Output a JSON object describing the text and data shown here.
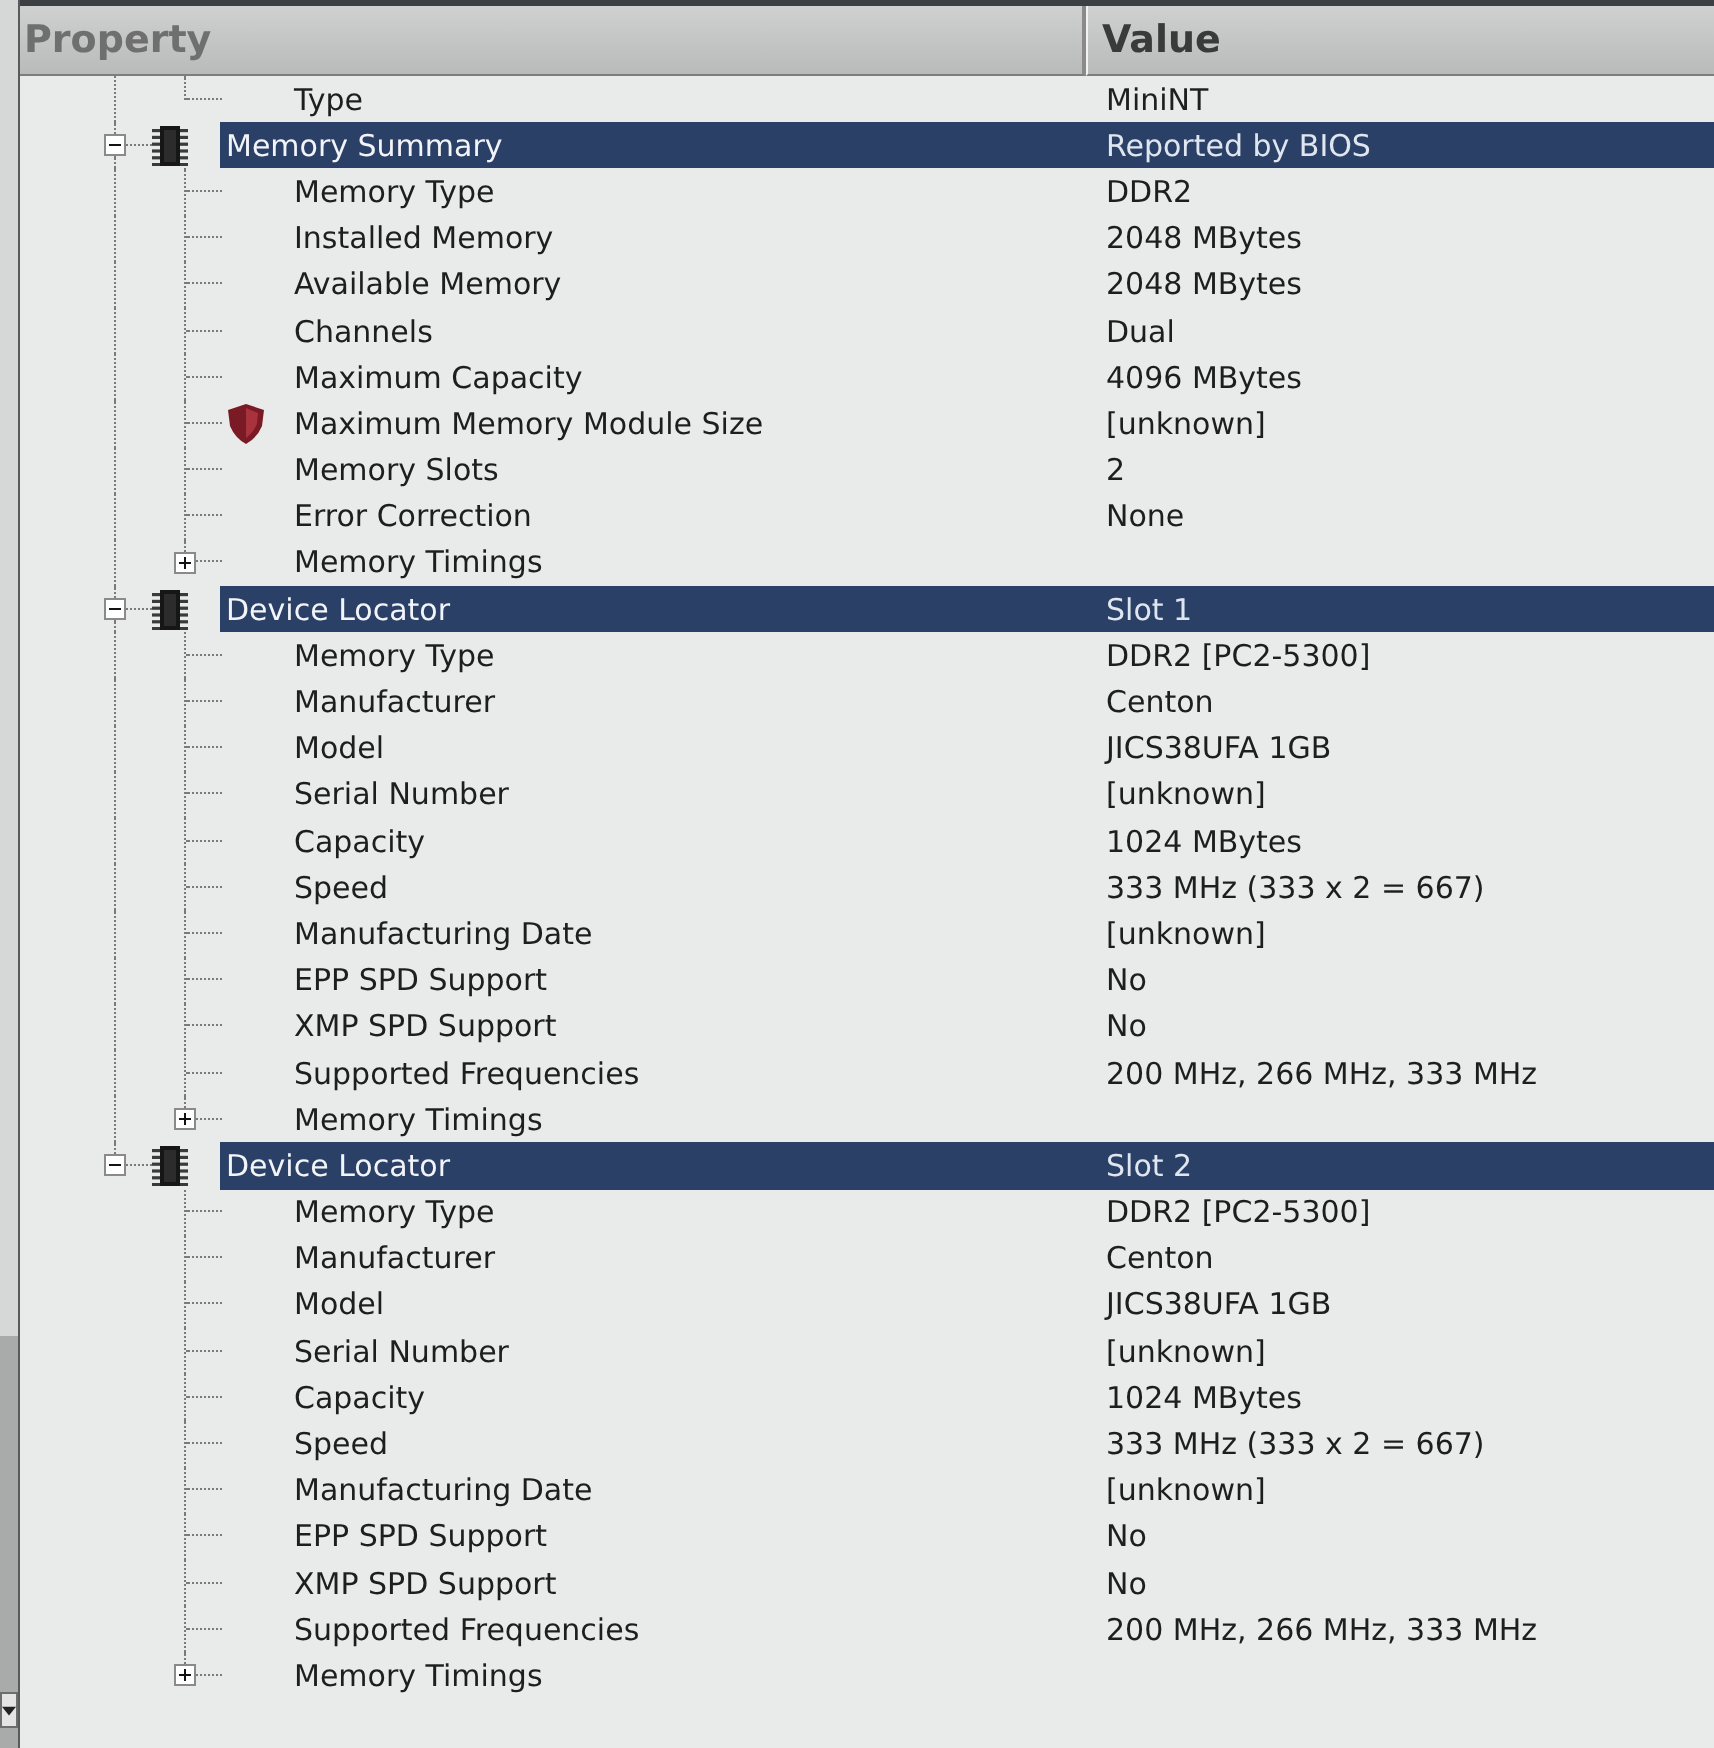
{
  "columns": [
    {
      "label": "Property"
    },
    {
      "label": "Value"
    }
  ],
  "continued_rows": [
    {
      "property": "Type",
      "value": "MiniNT"
    }
  ],
  "groups": [
    {
      "property": "Memory Summary",
      "value": "Reported by BIOS",
      "expanded": true,
      "children": [
        {
          "kind": "field",
          "property": "Memory Type",
          "value": "DDR2"
        },
        {
          "kind": "field",
          "property": "Installed Memory",
          "value": "2048 MBytes"
        },
        {
          "kind": "field",
          "property": "Available Memory",
          "value": "2048 MBytes"
        },
        {
          "kind": "field",
          "property": "Channels",
          "value": "Dual"
        },
        {
          "kind": "field",
          "property": "Maximum Capacity",
          "value": "4096 MBytes"
        },
        {
          "kind": "flagged",
          "property": "Maximum Memory Module Size",
          "value": "[unknown]"
        },
        {
          "kind": "field",
          "property": "Memory Slots",
          "value": "2"
        },
        {
          "kind": "field",
          "property": "Error Correction",
          "value": "None"
        },
        {
          "kind": "subtree",
          "property": "Memory Timings",
          "expanded": false
        }
      ]
    },
    {
      "property": "Device Locator",
      "value": "Slot 1",
      "expanded": true,
      "children": [
        {
          "kind": "field",
          "property": "Memory Type",
          "value": "DDR2 [PC2-5300]"
        },
        {
          "kind": "field",
          "property": "Manufacturer",
          "value": "Centon"
        },
        {
          "kind": "field",
          "property": "Model",
          "value": "JICS38UFA 1GB"
        },
        {
          "kind": "field",
          "property": "Serial Number",
          "value": "[unknown]"
        },
        {
          "kind": "field",
          "property": "Capacity",
          "value": "1024 MBytes"
        },
        {
          "kind": "field",
          "property": "Speed",
          "value": "333 MHz (333 x 2 = 667)"
        },
        {
          "kind": "field",
          "property": "Manufacturing Date",
          "value": "[unknown]"
        },
        {
          "kind": "field",
          "property": "EPP SPD Support",
          "value": "No"
        },
        {
          "kind": "field",
          "property": "XMP SPD Support",
          "value": "No"
        },
        {
          "kind": "field",
          "property": "Supported Frequencies",
          "value": "200 MHz, 266 MHz, 333 MHz"
        },
        {
          "kind": "subtree",
          "property": "Memory Timings",
          "expanded": false
        }
      ]
    },
    {
      "property": "Device Locator",
      "value": "Slot 2",
      "expanded": true,
      "children": [
        {
          "kind": "field",
          "property": "Memory Type",
          "value": "DDR2 [PC2-5300]"
        },
        {
          "kind": "field",
          "property": "Manufacturer",
          "value": "Centon"
        },
        {
          "kind": "field",
          "property": "Model",
          "value": "JICS38UFA 1GB"
        },
        {
          "kind": "field",
          "property": "Serial Number",
          "value": "[unknown]"
        },
        {
          "kind": "field",
          "property": "Capacity",
          "value": "1024 MBytes"
        },
        {
          "kind": "field",
          "property": "Speed",
          "value": "333 MHz (333 x 2 = 667)"
        },
        {
          "kind": "field",
          "property": "Manufacturing Date",
          "value": "[unknown]"
        },
        {
          "kind": "field",
          "property": "EPP SPD Support",
          "value": "No"
        },
        {
          "kind": "field",
          "property": "XMP SPD Support",
          "value": "No"
        },
        {
          "kind": "field",
          "property": "Supported Frequencies",
          "value": "200 MHz, 266 MHz, 333 MHz"
        },
        {
          "kind": "subtree",
          "property": "Memory Timings",
          "expanded": false
        }
      ]
    }
  ]
}
